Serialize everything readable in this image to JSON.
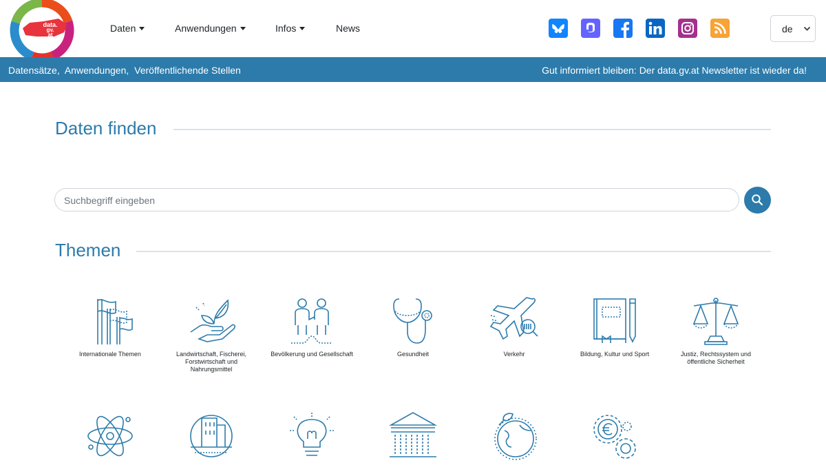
{
  "header": {
    "logo_text": "data.gv.at",
    "nav": [
      "Daten",
      "Anwendungen",
      "Infos",
      "News"
    ],
    "social_icons": [
      "bluesky-icon",
      "mastodon-icon",
      "facebook-icon",
      "linkedin-icon",
      "instagram-icon",
      "rss-icon"
    ],
    "language": "de"
  },
  "infobar": {
    "links": [
      "Datensätze,",
      "Anwendungen,",
      "Veröffentlichende Stellen"
    ],
    "news": "Gut informiert bleiben: Der data.gv.at Newsletter ist wieder da!"
  },
  "main": {
    "find_title": "Daten finden",
    "search_placeholder": "Suchbegriff eingeben",
    "themes_title": "Themen",
    "themes": [
      "Internationale Themen",
      "Landwirtschaft, Fischerei, Forstwirtschaft und Nahrungsmittel",
      "Bevölkerung und Gesellschaft",
      "Gesundheit",
      "Verkehr",
      "Bildung, Kultur und Sport",
      "Justiz, Rechtssystem und öffentliche Sicherheit"
    ],
    "themes_row2_icons": [
      "atom-icon",
      "city-icon",
      "lightbulb-icon",
      "government-building-icon",
      "globe-leaf-icon",
      "euro-gears-icon"
    ]
  },
  "colors": {
    "primary": "#2c7bab",
    "facebook": "#1877f2",
    "bluesky": "#1185fe",
    "mastodon": "#6364ff",
    "linkedin": "#0a66c2",
    "instagram": "#c13584",
    "rss": "#f7a336"
  }
}
